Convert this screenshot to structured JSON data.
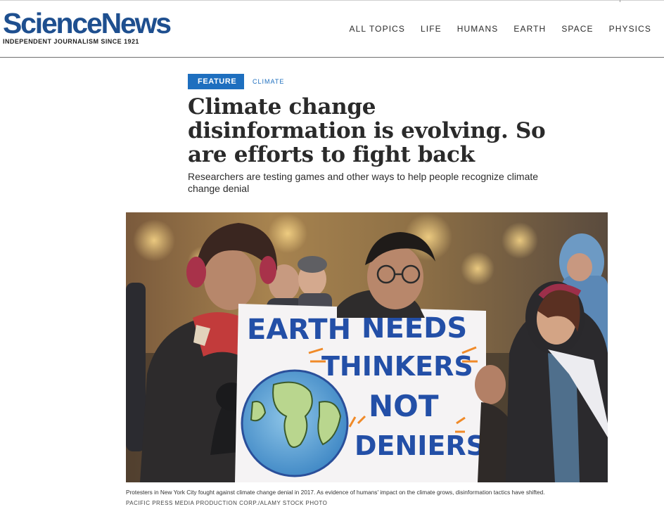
{
  "site": {
    "logo_text": "ScienceNews",
    "tagline": "INDEPENDENT JOURNALISM SINCE 1921",
    "brand_color": "#1e4f8f"
  },
  "nav": {
    "items": [
      {
        "label": "ALL TOPICS"
      },
      {
        "label": "LIFE"
      },
      {
        "label": "HUMANS"
      },
      {
        "label": "EARTH"
      },
      {
        "label": "SPACE"
      },
      {
        "label": "PHYSICS"
      }
    ]
  },
  "article": {
    "badge": "FEATURE",
    "badge_color": "#1e6fbf",
    "topic": "CLIMATE",
    "headline": "Climate change disinformation is evolving. So are efforts to fight back",
    "dek": "Researchers are testing games and other ways to help people recognize climate change denial",
    "image": {
      "sign_lines": [
        "EARTH",
        "NEEDS",
        "THINKERS",
        "NOT",
        "DENIERS"
      ],
      "caption": "Protesters in New York City fought against climate change denial in 2017. As evidence of humans' impact on the climate grows, disinformation tactics have shifted.",
      "credit": "PACIFIC PRESS MEDIA PRODUCTION CORP./ALAMY STOCK PHOTO"
    }
  }
}
